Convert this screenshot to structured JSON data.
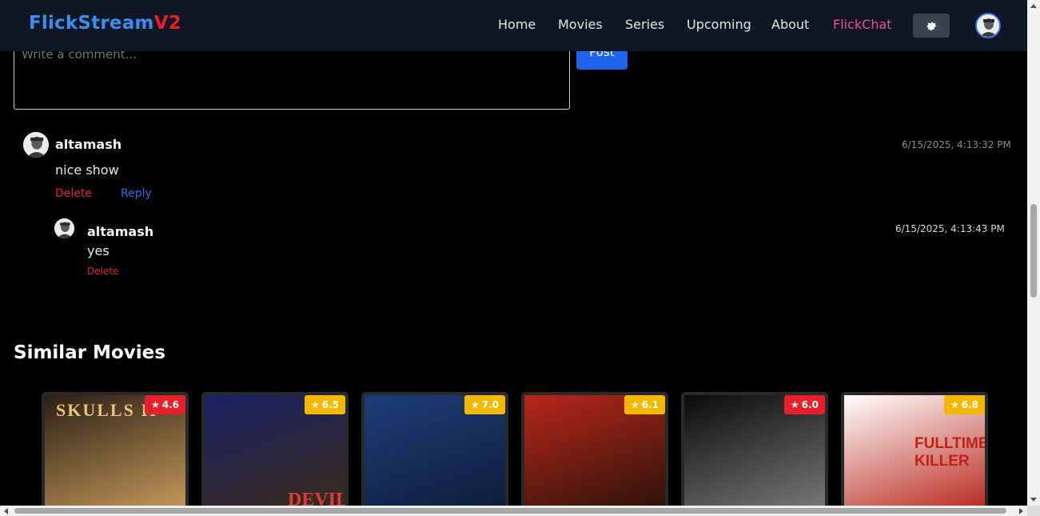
{
  "brand": {
    "part1": "FlickStream",
    "part2": "V2"
  },
  "nav": {
    "items": [
      {
        "label": "Home"
      },
      {
        "label": "Movies"
      },
      {
        "label": "Series"
      },
      {
        "label": "Upcoming"
      },
      {
        "label": "About"
      },
      {
        "label": "FlickChat"
      }
    ],
    "settings_icon": "gear-icon",
    "avatar_icon": "user-avatar"
  },
  "comment_form": {
    "placeholder": "Write a comment...",
    "post_label": "Post"
  },
  "comments": [
    {
      "user": "altamash",
      "text": "nice show",
      "timestamp": "6/15/2025, 4:13:32 PM",
      "delete_label": "Delete",
      "reply_label": "Reply",
      "replies": [
        {
          "user": "altamash",
          "text": "yes",
          "timestamp": "6/15/2025, 4:13:43 PM",
          "delete_label": "Delete"
        }
      ]
    }
  ],
  "similar": {
    "title": "Similar Movies",
    "movies": [
      {
        "rating": "4.6",
        "badge_color": "#e8202a",
        "poster_text": "SKULLS II",
        "poster_colors": [
          "#2a2016",
          "#c89a5a"
        ]
      },
      {
        "rating": "6.5",
        "badge_color": "#f5b800",
        "poster_text": "DEVIL",
        "poster_colors": [
          "#1a2266",
          "#3a2a18"
        ]
      },
      {
        "rating": "7.0",
        "badge_color": "#f5b800",
        "poster_text": "",
        "poster_colors": [
          "#1c3e78",
          "#0d1c3a"
        ]
      },
      {
        "rating": "6.1",
        "badge_color": "#f5b800",
        "poster_text": "",
        "poster_colors": [
          "#b8261a",
          "#2a1208"
        ]
      },
      {
        "rating": "6.0",
        "badge_color": "#e8202a",
        "poster_text": "",
        "poster_colors": [
          "#0a0a0a",
          "#7a7a7a"
        ]
      },
      {
        "rating": "6.8",
        "badge_color": "#f5b800",
        "poster_text": "FULLTIME KILLER",
        "poster_colors": [
          "#ffffff",
          "#b8261a"
        ]
      }
    ]
  }
}
